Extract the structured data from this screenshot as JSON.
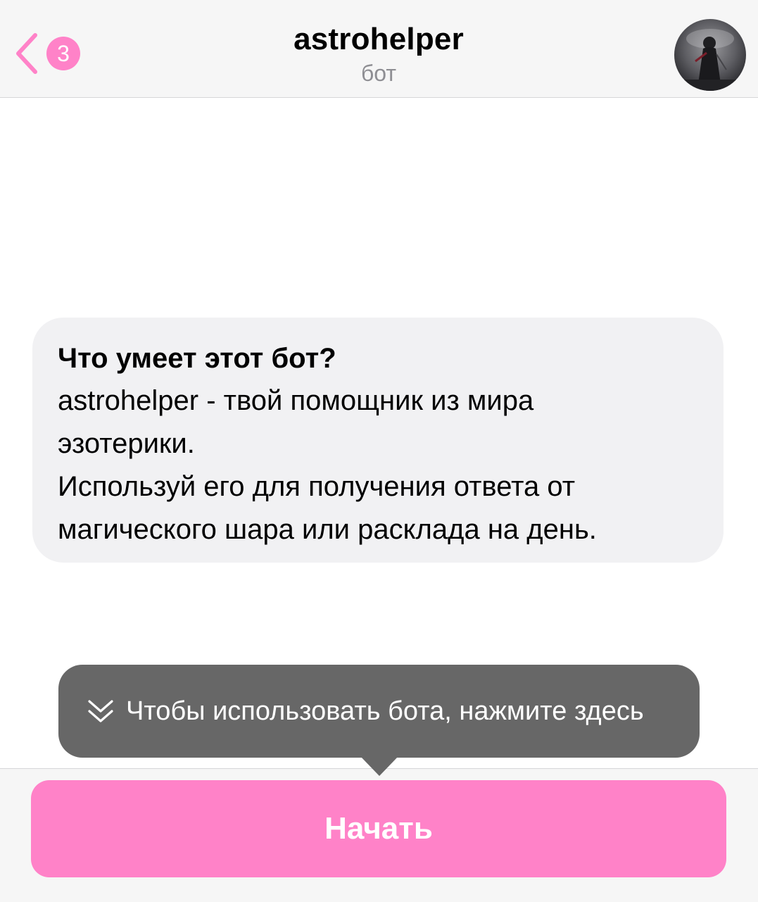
{
  "header": {
    "back_icon": "chevron-left-icon",
    "unread_count": "3",
    "title": "astrohelper",
    "subtitle": "бот"
  },
  "info_bubble": {
    "heading": "Что умеет этот бот?",
    "body": "astrohelper - твой помощник из мира\nэзотерики.\nИспользуй его для получения ответа от\nмагического шара или расклада на день."
  },
  "tooltip": {
    "icon": "double-chevron-down-icon",
    "text": "Чтобы использовать бота, нажмите здесь"
  },
  "bottom_bar": {
    "start_label": "Начать"
  },
  "colors": {
    "accent": "#ff82c8",
    "header_bg": "#f6f6f6",
    "bubble_bg": "#f1f1f3",
    "tooltip_bg": "#676767",
    "subtitle_text": "#8e8e93"
  }
}
